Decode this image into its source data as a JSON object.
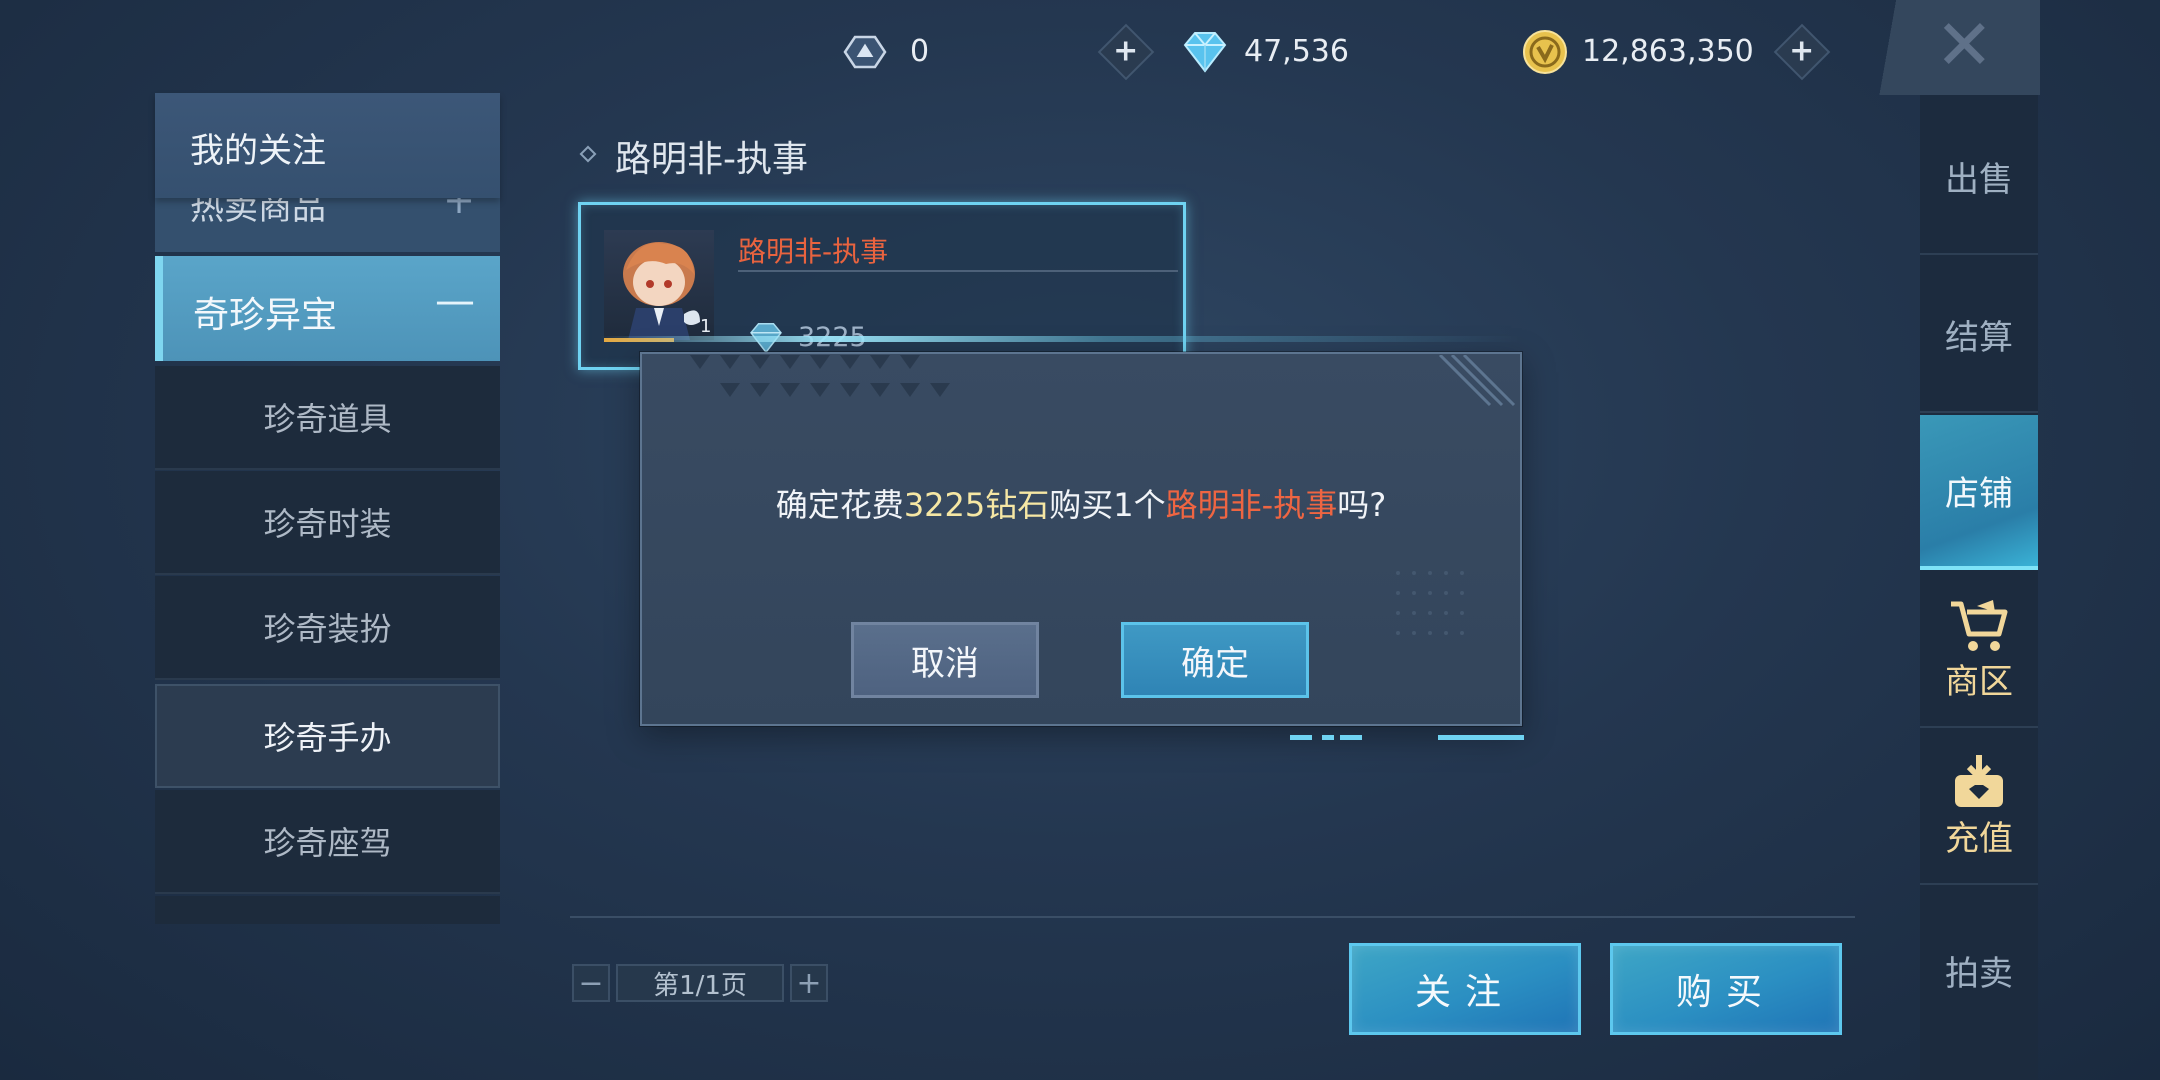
{
  "currency": {
    "tickets": "0",
    "diamonds": "47,536",
    "coins": "12,863,350",
    "plus_label": "+"
  },
  "left_menu": {
    "header": "我的关注",
    "hidden_item": "热卖商品",
    "hidden_item_toggle": "+",
    "category": "奇珍异宝",
    "category_toggle": "—",
    "subitems": [
      "珍奇道具",
      "珍奇时装",
      "珍奇装扮",
      "珍奇手办",
      "珍奇座驾"
    ],
    "active_subitem": "珍奇手办"
  },
  "main": {
    "section_title": "路明非-执事",
    "item": {
      "name": "路明非-执事",
      "count": "1",
      "price": "3225"
    },
    "pager": {
      "minus": "−",
      "text": "第1/1页",
      "plus": "+"
    },
    "follow_button": "关注",
    "buy_button": "购买"
  },
  "right_tabs": {
    "sell": "出售",
    "checkout": "结算",
    "shop": "店铺",
    "mall": "商区",
    "recharge": "充值",
    "auction": "拍卖"
  },
  "dialog": {
    "msg_prefix": "确定花费",
    "msg_amount": "3225钻石",
    "msg_middle": "购买1个",
    "msg_name": "路明非-执事",
    "msg_suffix": "吗?",
    "cancel": "取消",
    "confirm": "确定"
  },
  "colors": {
    "accent_cyan": "#6fd3f2",
    "highlight_orange": "#ee6542",
    "highlight_gold": "#f6e7a4",
    "mall_gold": "#f1d79a"
  }
}
